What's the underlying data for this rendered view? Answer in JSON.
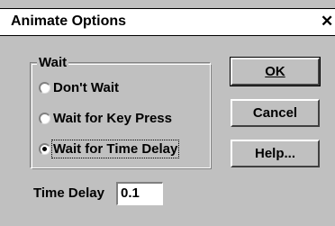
{
  "window": {
    "title": "Animate Options",
    "close_glyph": "✕"
  },
  "wait_group": {
    "legend": "Wait",
    "options": [
      {
        "label": "Don't Wait",
        "checked": false
      },
      {
        "label": "Wait for Key Press",
        "checked": false
      },
      {
        "label": "Wait for Time Delay",
        "checked": true
      }
    ]
  },
  "buttons": {
    "ok_label": "OK",
    "cancel_label": "Cancel",
    "help_label": "Help..."
  },
  "time_delay": {
    "label": "Time Delay",
    "value": "0.1"
  }
}
